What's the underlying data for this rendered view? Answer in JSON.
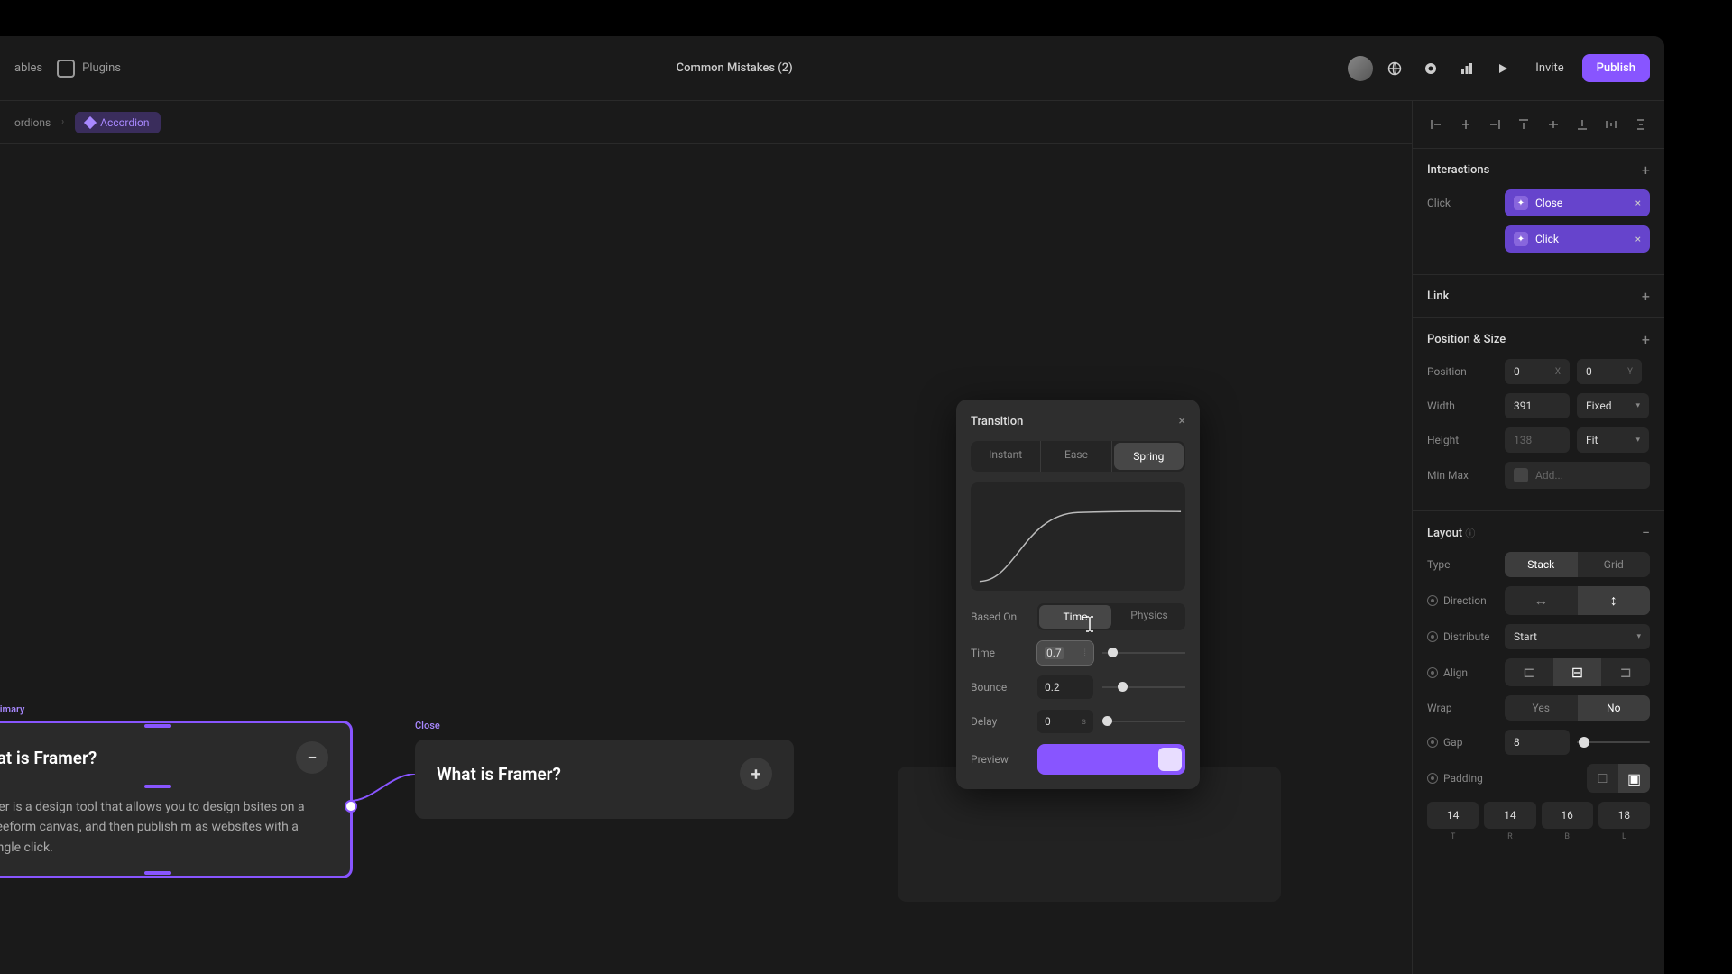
{
  "topbar": {
    "variables": "ables",
    "plugins": "Plugins",
    "title": "Common Mistakes (2)",
    "invite": "Invite",
    "publish": "Publish"
  },
  "breadcrumb": {
    "parent": "ordions",
    "active": "Accordion"
  },
  "cards": {
    "open": {
      "label": "pen · Primary",
      "title": "hat is Framer?",
      "body": "mer is a design tool that allows you to design bsites on a freeform canvas, and then publish m as websites with a single click."
    },
    "close": {
      "label": "Close",
      "title": "What is Framer?"
    }
  },
  "transition": {
    "title": "Transition",
    "tabs": {
      "instant": "Instant",
      "ease": "Ease",
      "spring": "Spring"
    },
    "basedOn": {
      "label": "Based On",
      "time": "Time",
      "physics": "Physics"
    },
    "time": {
      "label": "Time",
      "value": "0.7"
    },
    "bounce": {
      "label": "Bounce",
      "value": "0.2"
    },
    "delay": {
      "label": "Delay",
      "value": "0",
      "unit": "s"
    },
    "preview": "Preview"
  },
  "panel": {
    "interactions": {
      "title": "Interactions",
      "trigger": "Click",
      "items": [
        {
          "label": "Close"
        },
        {
          "label": "Click"
        }
      ]
    },
    "link": {
      "title": "Link"
    },
    "posSize": {
      "title": "Position & Size",
      "position": {
        "label": "Position",
        "x": "0",
        "y": "0",
        "xu": "X",
        "yu": "Y"
      },
      "width": {
        "label": "Width",
        "value": "391",
        "mode": "Fixed"
      },
      "height": {
        "label": "Height",
        "value": "138",
        "mode": "Fit"
      },
      "minmax": {
        "label": "Min Max",
        "placeholder": "Add..."
      }
    },
    "layout": {
      "title": "Layout",
      "type": {
        "label": "Type",
        "stack": "Stack",
        "grid": "Grid"
      },
      "direction": "Direction",
      "distribute": {
        "label": "Distribute",
        "value": "Start"
      },
      "align": "Align",
      "wrap": {
        "label": "Wrap",
        "yes": "Yes",
        "no": "No"
      },
      "gap": {
        "label": "Gap",
        "value": "8"
      },
      "padding": {
        "label": "Padding",
        "t": "14",
        "r": "14",
        "b": "16",
        "l": "18",
        "tl": "T",
        "rl": "R",
        "bl": "B",
        "ll": "L"
      }
    }
  }
}
